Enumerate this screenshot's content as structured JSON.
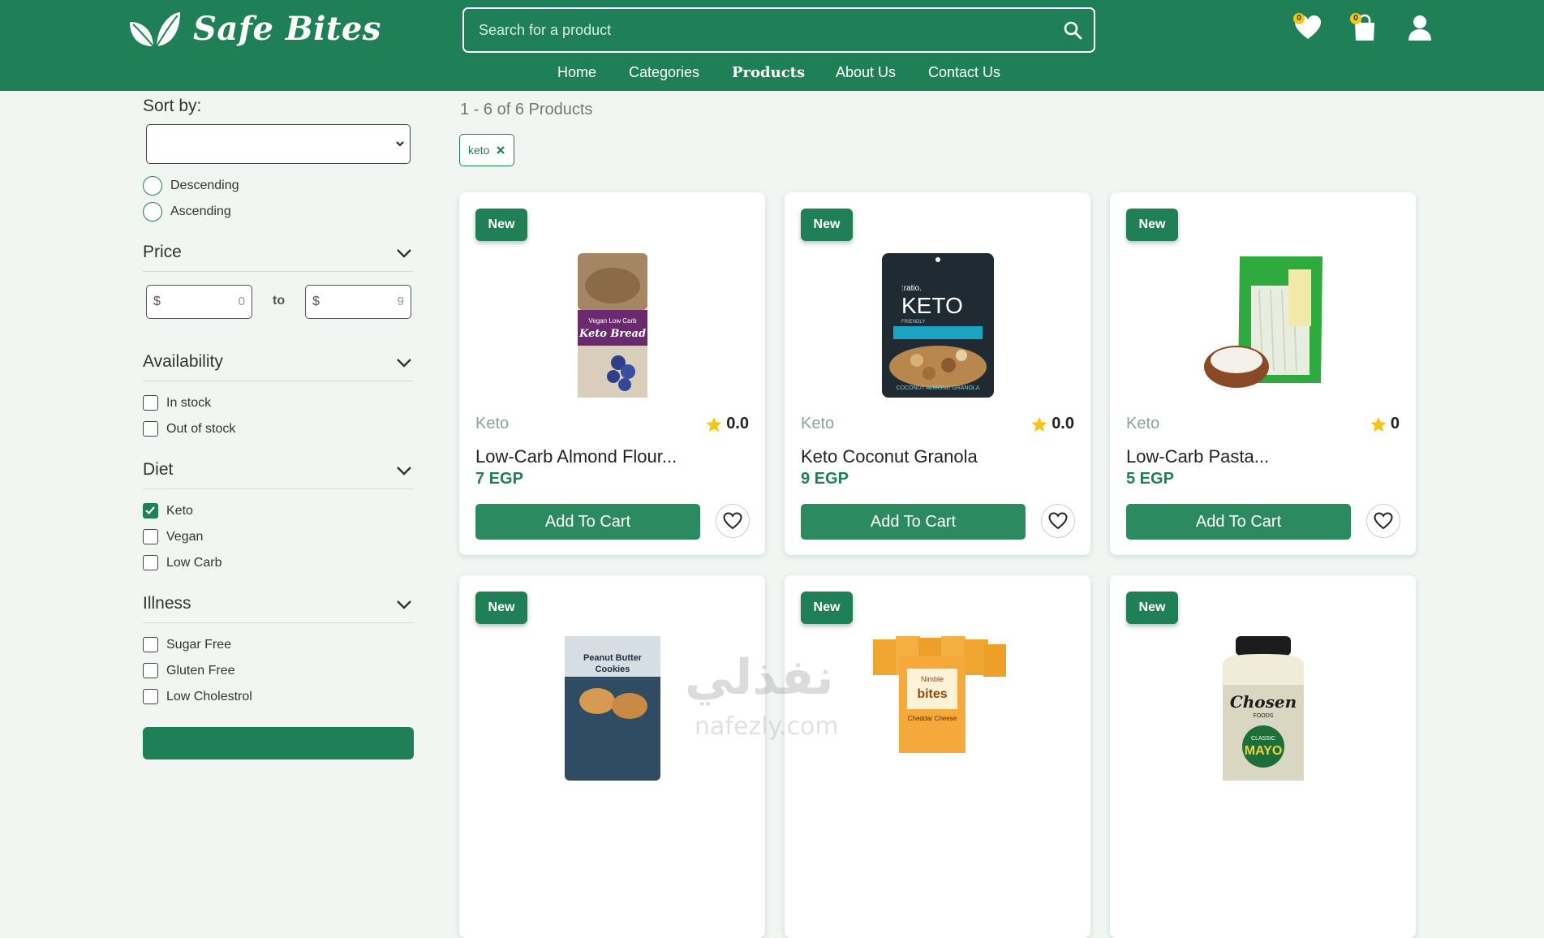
{
  "brand": {
    "name": "Safe Bites"
  },
  "search": {
    "placeholder": "Search for a product"
  },
  "header_icons": {
    "wishlist_count": "0",
    "cart_count": "0"
  },
  "nav": [
    {
      "label": "Home"
    },
    {
      "label": "Categories"
    },
    {
      "label": "Products",
      "active": true
    },
    {
      "label": "About Us"
    },
    {
      "label": "Contact Us"
    }
  ],
  "sidebar": {
    "sort_by_label": "Sort by:",
    "sort_selected": "",
    "order_options": [
      "Descending",
      "Ascending"
    ],
    "price": {
      "title": "Price",
      "currency": "$",
      "min": "0",
      "max": "9",
      "to_label": "to"
    },
    "availability": {
      "title": "Availability",
      "options": [
        "In stock",
        "Out of stock"
      ]
    },
    "diet": {
      "title": "Diet",
      "options": [
        "Keto",
        "Vegan",
        "Low Carb"
      ],
      "checked": [
        "Keto"
      ]
    },
    "illness": {
      "title": "Illness",
      "options": [
        "Sugar Free",
        "Gluten Free",
        "Low Cholestrol"
      ]
    }
  },
  "results": {
    "count_text": "1 - 6 of 6 Products"
  },
  "active_filters": [
    {
      "label": "keto"
    }
  ],
  "products": [
    {
      "badge": "New",
      "category": "Keto",
      "rating": "0.0",
      "name": "Low-Carb Almond Flour...",
      "price": "7 EGP",
      "button": "Add To Cart"
    },
    {
      "badge": "New",
      "category": "Keto",
      "rating": "0.0",
      "name": "Keto Coconut Granola",
      "price": "9 EGP",
      "button": "Add To Cart"
    },
    {
      "badge": "New",
      "category": "Keto",
      "rating": "0",
      "name": "Low-Carb Pasta...",
      "price": "5 EGP",
      "button": "Add To Cart"
    },
    {
      "badge": "New"
    },
    {
      "badge": "New"
    },
    {
      "badge": "New"
    }
  ],
  "product_images": {
    "p1_lines": [
      "Vegan Low Carb",
      "Keto Bread"
    ],
    "p2_lines": [
      ":ratio.",
      "KETO",
      "FRIENDLY",
      "COCONUT ALMOND GRANOLA"
    ],
    "p4_lines": [
      "Peanut Butter",
      "Cookies"
    ],
    "p5_lines": [
      "Nimble",
      "bites",
      "Cheddar Cheese"
    ],
    "p6_lines": [
      "Chosen",
      "FOODS",
      "CLASSIC",
      "MAYO"
    ]
  },
  "watermark": {
    "arabic": "نفذلي",
    "latin": "nafezly.com"
  },
  "colors": {
    "brand": "#1f7f57",
    "background": "#f1f6f3",
    "star": "#f5c518"
  }
}
